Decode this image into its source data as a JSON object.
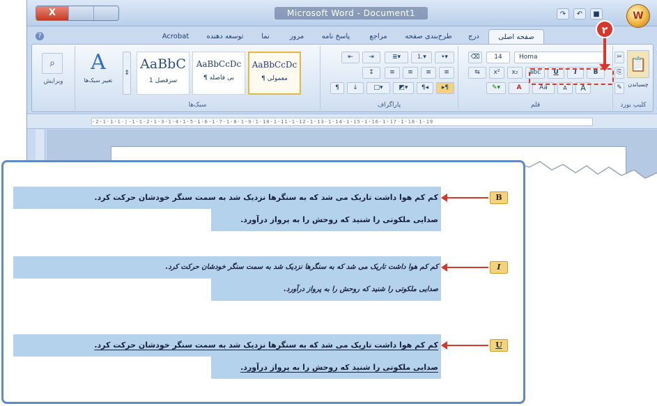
{
  "window": {
    "title": "Microsoft Word - Document1",
    "close_glyph": "X"
  },
  "qat": {
    "save": "■",
    "undo": "↶",
    "redo": "↷"
  },
  "office_button": "W",
  "tabs": [
    {
      "label": "صفحه اصلی",
      "active": true
    },
    {
      "label": "درج",
      "active": false
    },
    {
      "label": "طرح‌بندی صفحه",
      "active": false
    },
    {
      "label": "مراجع",
      "active": false
    },
    {
      "label": "پاسخ نامه",
      "active": false
    },
    {
      "label": "مرور",
      "active": false
    },
    {
      "label": "نما",
      "active": false
    },
    {
      "label": "توسعه دهنده",
      "active": false
    },
    {
      "label": "Acrobat",
      "active": false
    }
  ],
  "ribbon": {
    "font": {
      "name": "Homa",
      "size": "14",
      "label": "قلم",
      "bold": "B",
      "italic": "I",
      "underline": "U",
      "strike": "abc",
      "subscript": "x₂",
      "superscript": "x²",
      "grow": "A",
      "shrink": "A",
      "change_case": "Aa",
      "font_color": "A"
    },
    "clipboard": {
      "label": "کلیپ بورد",
      "paste": "چسباندن"
    },
    "paragraph": {
      "label": "پاراگراف"
    },
    "styles": {
      "label": "سبک‌ها",
      "items": [
        {
          "sample": "AaBbCcDc",
          "name": "¶ معمولی",
          "selected": true
        },
        {
          "sample": "AaBbCcDc",
          "name": "¶ بی فاصله",
          "selected": false
        },
        {
          "sample": "AaBbC",
          "name": "سرفصل 1",
          "selected": false
        }
      ],
      "change_styles": "تغییر سبک‌ها"
    },
    "editing": {
      "label": "ویرایش"
    }
  },
  "annotation": {
    "step": "۲"
  },
  "ruler": {
    "scale": "·2·1·1·1·|·1·1·2·1·3·1·4·1·5·1·6·1·7·1·8·1·9·1·10·1·11·1·12·1·13·1·14·1·15·1·16·1·17·1·18·1·19"
  },
  "samples": [
    {
      "marker": "B",
      "line1": "کم کم هوا داشت تاریک می شد که به سنگرها نزدیک شد به سمت سنگر خودشان حرکت کرد.",
      "line2": "صدایی ملکوتی را شنید که روحش را به پرواز درآورد."
    },
    {
      "marker": "I",
      "line1": "کم کم هوا داشت تاریک می شد که به سنگرها نزدیک شد به سمت سنگر خودشان حرکت کرد.",
      "line2": "صدایی ملکوتی را شنید که روحش را به پرواز درآورد."
    },
    {
      "marker": "U",
      "line1": "کم کم هوا داشت تاریک می شد که به سنگرها نزدیک شد به سمت سنگر خودشان حرکت کرد.",
      "line2": "صدایی ملکوتی را شنید که روحش را به پرواز درآورد."
    }
  ],
  "colors": {
    "accent": "#d7372a",
    "highlight": "#b5d2ec",
    "marker": "#f6d27a",
    "panel_border": "#5e8ac5"
  }
}
